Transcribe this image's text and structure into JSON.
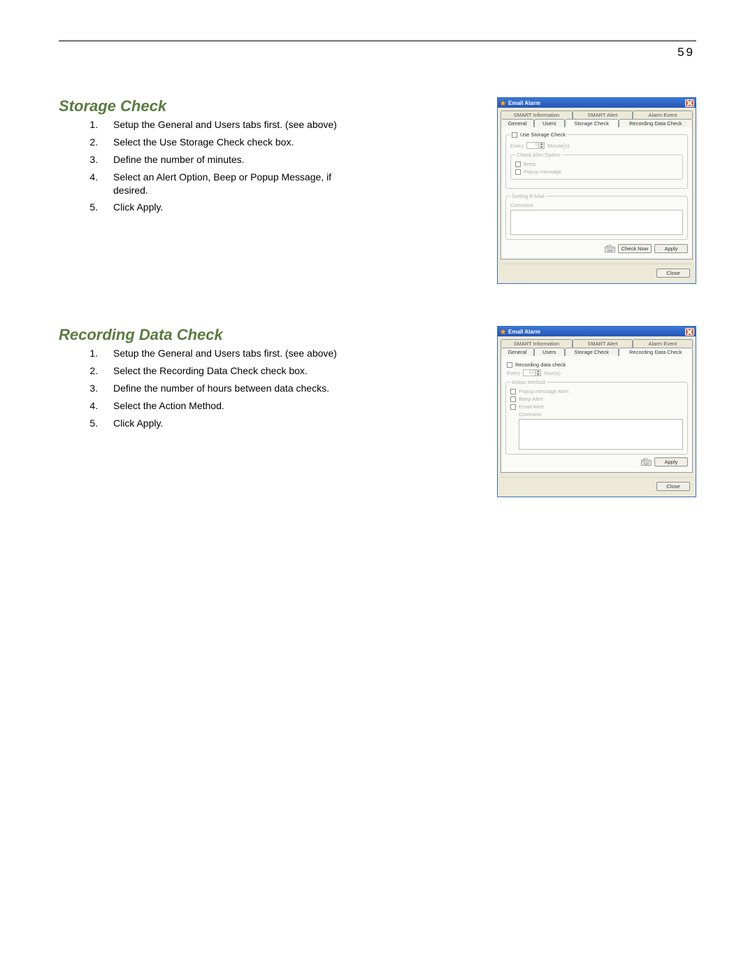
{
  "page_number": "59",
  "section1": {
    "title": "Storage Check",
    "steps": [
      "Setup the General and Users tabs first. (see above)",
      "Select the Use Storage Check check box.",
      "Define the number of minutes.",
      "Select an Alert Option, Beep or Popup Message, if desired.",
      "Click Apply."
    ]
  },
  "section2": {
    "title": "Recording Data Check",
    "steps": [
      "Setup the General and Users tabs first. (see above)",
      "Select the Recording Data Check check box.",
      "Define the number of hours between data checks.",
      "Select the Action Method.",
      "Click Apply."
    ]
  },
  "dialog_common": {
    "window_title": "Email Alarm",
    "tabs_back": [
      "SMART Information",
      "SMART Alert",
      "Alarm Event"
    ],
    "tabs_front": [
      "General",
      "Users",
      "Storage Check",
      "Recording Data Check"
    ],
    "close_label": "Close"
  },
  "dlg1": {
    "active_tab": "Storage Check",
    "use_check_label": "Use Storage Check",
    "every_label": "Every",
    "every_value": "0",
    "every_unit": "Minute(s)",
    "alert_legend": "Check Alert Option",
    "beep_label": "Beep",
    "popup_label": "Popup message",
    "email_legend": "Setting E-Mail",
    "comment_label": "Comment",
    "keyboard_icon": "keyboard-icon",
    "check_now_label": "Check Now",
    "apply_label": "Apply"
  },
  "dlg2": {
    "active_tab": "Recording Data Check",
    "use_check_label": "Recording data check",
    "every_label": "Every",
    "every_value": "12",
    "every_unit": "hour(s)",
    "action_legend": "Action Method",
    "popup_alert_label": "Popup message Alert",
    "beep_alert_label": "Beep Alert",
    "email_alert_label": "Email Alert",
    "comment_label": "Comment",
    "keyboard_icon": "keyboard-icon",
    "apply_label": "Apply"
  }
}
